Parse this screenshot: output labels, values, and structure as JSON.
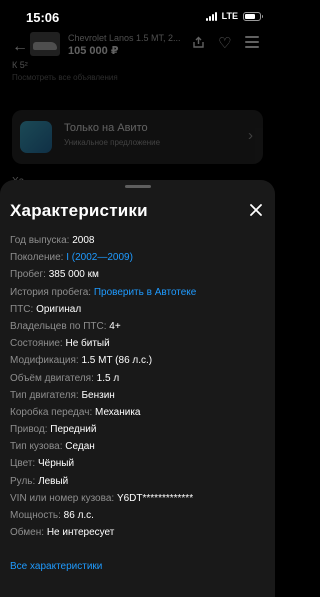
{
  "status_bar": {
    "time": "15:06",
    "network": "LTE",
    "battery_level": 0.72
  },
  "background": {
    "title": "Chevrolet Lanos 1.5 MT, 2...",
    "price": "105 000 ₽",
    "small_text": "К 5²",
    "small_text_2": "Посмотреть все объявления",
    "promo_title": "Только на Авито",
    "promo_subtitle": "Уникальное предложение",
    "edge_text": "Ха"
  },
  "sheet": {
    "title": "Характеристики",
    "specs": [
      {
        "label": "Год выпуска:",
        "value": "2008",
        "link": false
      },
      {
        "label": "Поколение:",
        "value": "I (2002—2009)",
        "link": true
      },
      {
        "label": "Пробег:",
        "value": "385 000 км",
        "link": false
      },
      {
        "label": "История пробега:",
        "value": "Проверить в Автотеке",
        "link": true
      },
      {
        "label": "ПТС:",
        "value": "Оригинал",
        "link": false
      },
      {
        "label": "Владельцев по ПТС:",
        "value": "4+",
        "link": false
      },
      {
        "label": "Состояние:",
        "value": "Не битый",
        "link": false
      },
      {
        "label": "Модификация:",
        "value": "1.5 MT (86 л.с.)",
        "link": false
      },
      {
        "label": "Объём двигателя:",
        "value": "1.5 л",
        "link": false
      },
      {
        "label": "Тип двигателя:",
        "value": "Бензин",
        "link": false
      },
      {
        "label": "Коробка передач:",
        "value": "Механика",
        "link": false
      },
      {
        "label": "Привод:",
        "value": "Передний",
        "link": false
      },
      {
        "label": "Тип кузова:",
        "value": "Седан",
        "link": false
      },
      {
        "label": "Цвет:",
        "value": "Чёрный",
        "link": false
      },
      {
        "label": "Руль:",
        "value": "Левый",
        "link": false
      },
      {
        "label": "VIN или номер кузова:",
        "value": "Y6DT*************",
        "link": false
      },
      {
        "label": "Мощность:",
        "value": "86 л.с.",
        "link": false
      },
      {
        "label": "Обмен:",
        "value": "Не интересует",
        "link": false
      }
    ],
    "all_specs_link": "Все характеристики"
  },
  "colors": {
    "link": "#1f9bff",
    "label": "#8e8e8e",
    "sheet_bg": "#191919"
  },
  "icons": [
    "signal-icon",
    "battery-icon",
    "close-icon",
    "back-arrow-icon",
    "share-icon",
    "heart-icon",
    "menu-icon",
    "chevron-right-icon"
  ]
}
